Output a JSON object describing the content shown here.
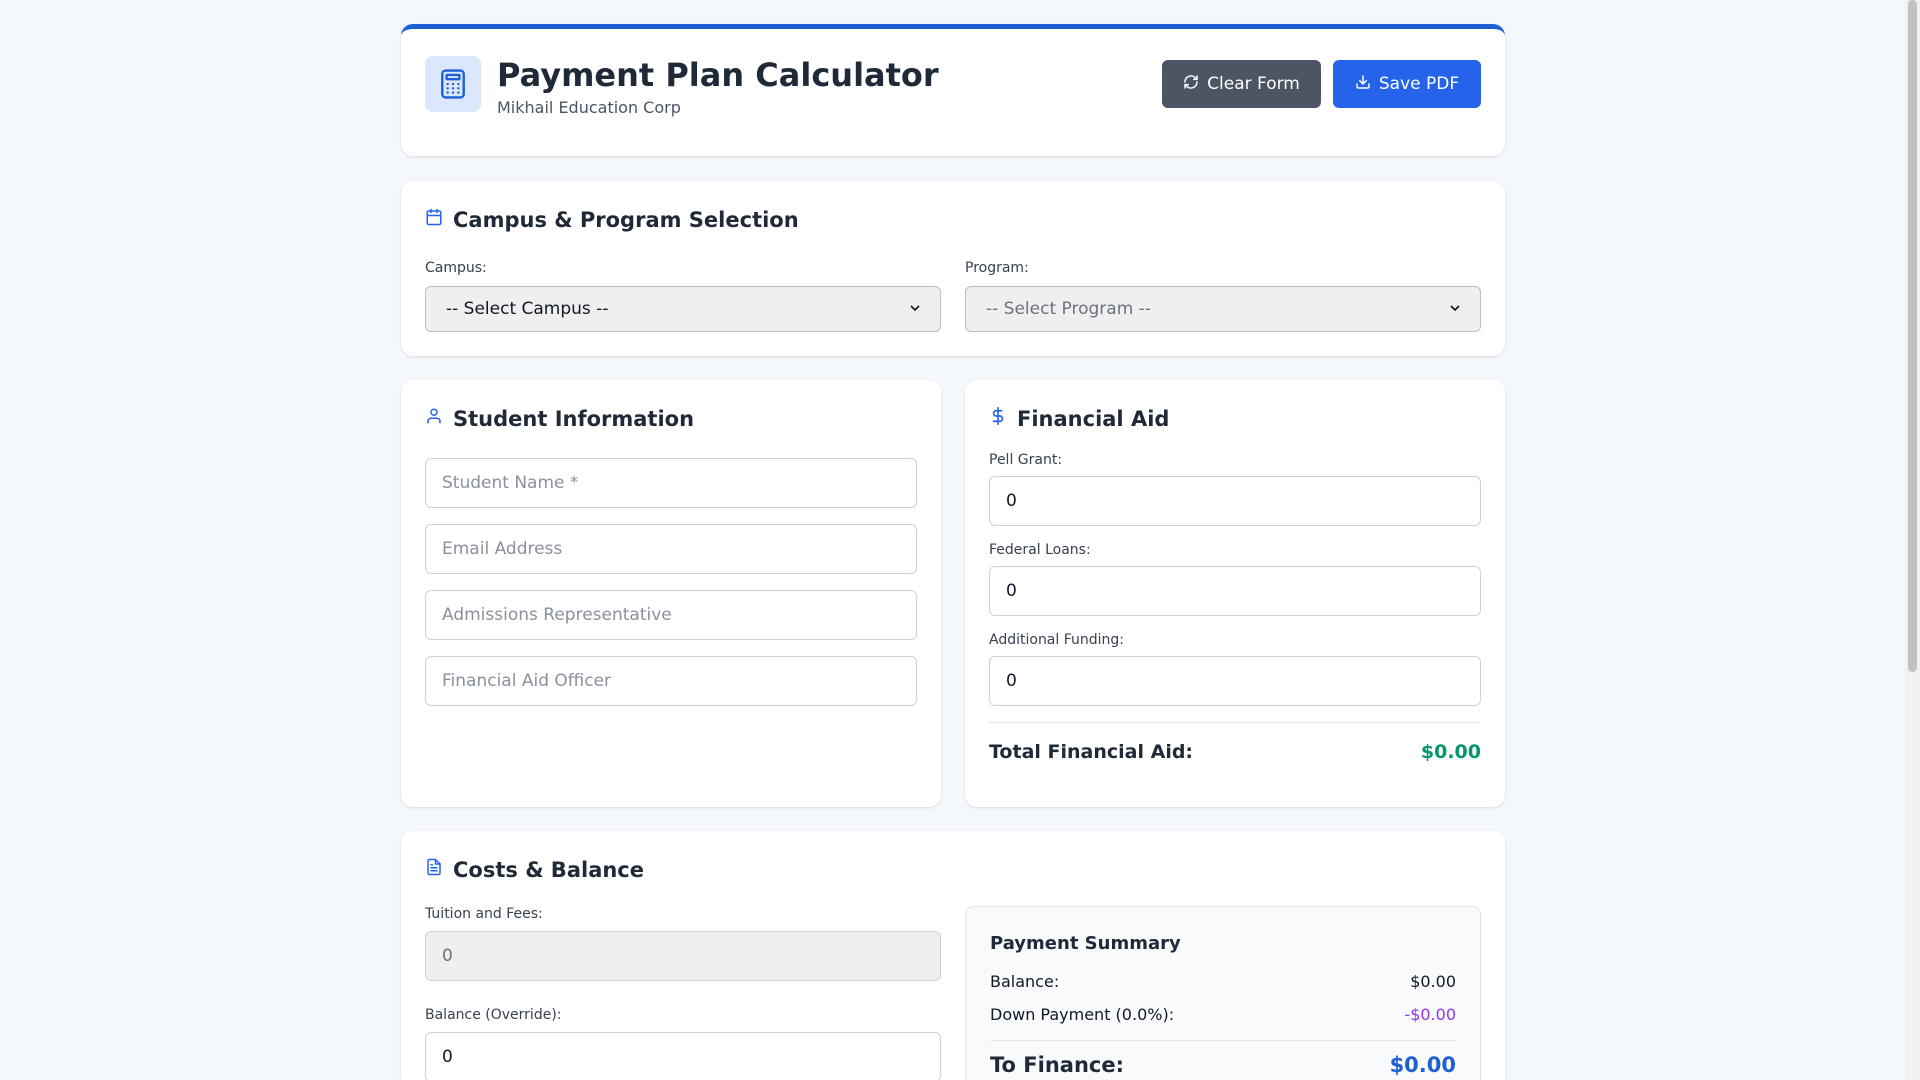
{
  "header": {
    "title": "Payment Plan Calculator",
    "subtitle": "Mikhail Education Corp",
    "clear_label": "Clear Form",
    "save_label": "Save PDF"
  },
  "campus_section": {
    "title": "Campus & Program Selection",
    "campus_label": "Campus:",
    "campus_value": "-- Select Campus --",
    "program_label": "Program:",
    "program_value": "-- Select Program --"
  },
  "student_section": {
    "title": "Student Information",
    "name_placeholder": "Student Name *",
    "email_placeholder": "Email Address",
    "rep_placeholder": "Admissions Representative",
    "officer_placeholder": "Financial Aid Officer"
  },
  "aid_section": {
    "title": "Financial Aid",
    "pell_label": "Pell Grant:",
    "pell_value": "0",
    "loans_label": "Federal Loans:",
    "loans_value": "0",
    "additional_label": "Additional Funding:",
    "additional_value": "0",
    "total_label": "Total Financial Aid:",
    "total_value": "$0.00"
  },
  "costs_section": {
    "title": "Costs & Balance",
    "tuition_label": "Tuition and Fees:",
    "tuition_value": "0",
    "balance_label": "Balance (Override):",
    "balance_value": "0"
  },
  "summary": {
    "title": "Payment Summary",
    "balance_label": "Balance:",
    "balance_value": "$0.00",
    "down_label": "Down Payment (0.0%):",
    "down_value": "-$0.00",
    "finance_label": "To Finance:",
    "finance_value": "$0.00"
  },
  "colors": {
    "accent": "#1d5fd4",
    "button_blue": "#2563eb",
    "button_dark": "#4b5563",
    "aid_total": "#059669",
    "down_payment": "#9333ea"
  },
  "icons": {
    "app": "calculator-icon",
    "clear": "refresh-icon",
    "save": "download-icon",
    "campus": "calendar-icon",
    "student": "user-icon",
    "aid": "dollar-icon",
    "costs": "document-icon"
  }
}
